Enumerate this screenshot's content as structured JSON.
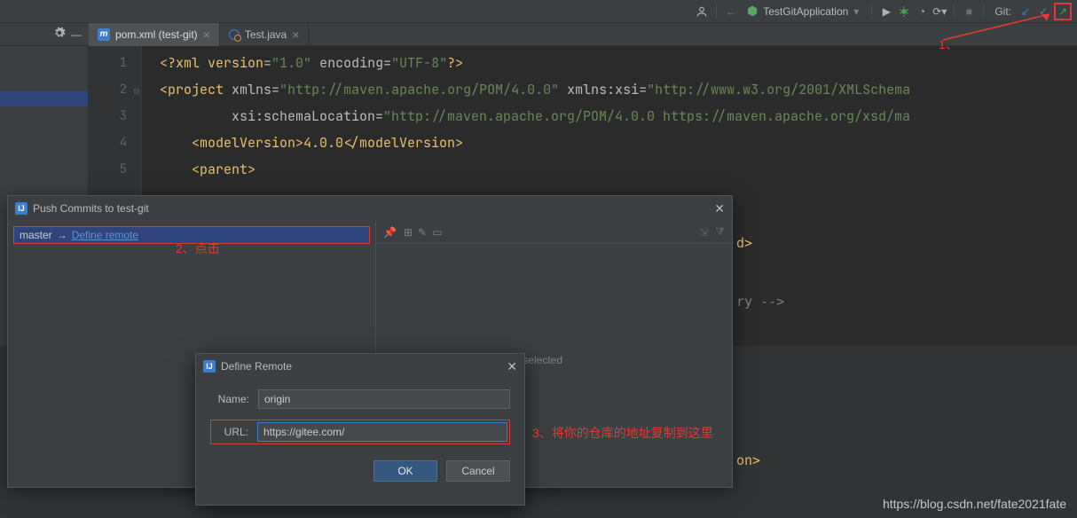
{
  "topbar": {
    "run_config": "TestGitApplication",
    "git_label": "Git:"
  },
  "tabs": {
    "pom": {
      "label": "pom.xml (test-git)"
    },
    "test": {
      "label": "Test.java"
    }
  },
  "editor": {
    "line_numbers": [
      "1",
      "2",
      "3",
      "4",
      "5"
    ],
    "line1_a": "<?",
    "line1_b": "xml version",
    "line1_c": "=",
    "line1_d": "\"1.0\"",
    "line1_e": " encoding",
    "line1_f": "=",
    "line1_g": "\"UTF-8\"",
    "line1_h": "?>",
    "line2_a": "<",
    "line2_b": "project ",
    "line2_c": "xmlns",
    "line2_d": "=",
    "line2_e": "\"http://maven.apache.org/POM/4.0.0\"",
    "line2_f": " xmlns:xsi",
    "line2_g": "=",
    "line2_h": "\"http://www.w3.org/2001/XMLSchema",
    "line3_a": "         xsi",
    "line3_b": ":schemaLocation",
    "line3_c": "=",
    "line3_d": "\"http://maven.apache.org/POM/4.0.0 https://maven.apache.org/xsd/ma",
    "line4_a": "    <",
    "line4_b": "modelVersion",
    "line4_c": ">4.0.0</",
    "line4_d": "modelVersion",
    "line4_e": ">",
    "line5_a": "    <",
    "line5_b": "parent",
    "line5_c": ">",
    "partial_d": "d>",
    "partial_ry": "ry -->",
    "partial_on": "on>"
  },
  "push_dialog": {
    "title": "Push Commits to test-git",
    "branch": "master",
    "arrow": "→",
    "define_remote": "Define remote",
    "no_commits": "mits selected"
  },
  "define_remote_dialog": {
    "title": "Define Remote",
    "name_label": "Name:",
    "name_value": "origin",
    "url_label": "URL:",
    "url_value": "https://gitee.com/",
    "ok": "OK",
    "cancel": "Cancel"
  },
  "annotations": {
    "a1": "1、",
    "a2": "2、点击",
    "a3": "3、将你的仓库的地址复制到这里"
  },
  "watermark": "https://blog.csdn.net/fate2021fate"
}
